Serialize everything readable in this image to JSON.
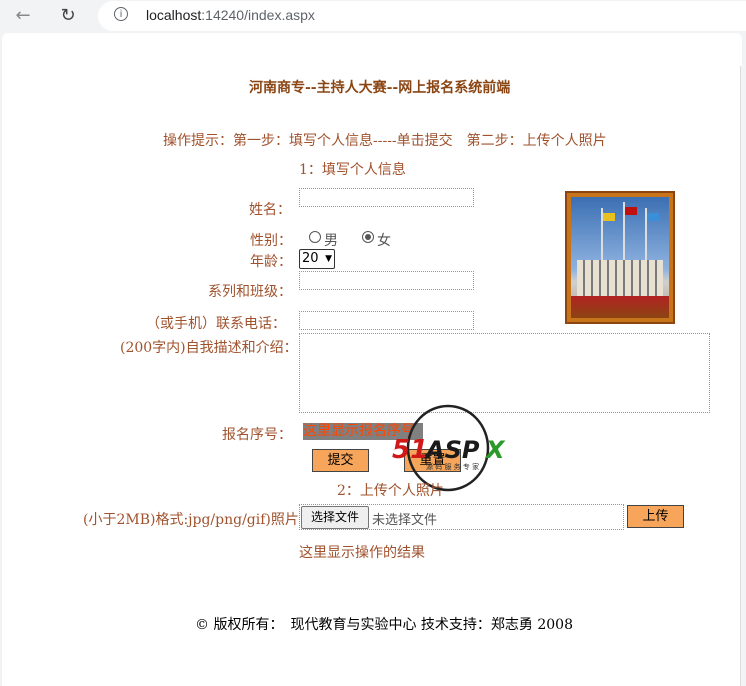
{
  "browser": {
    "url_host": "localhost",
    "url_rest": ":14240/index.aspx"
  },
  "page": {
    "title": "河南商专--主持人大赛--网上报名系统前端",
    "hint": "操作提示：第一步：填写个人信息-----单击提交　第二步：上传个人照片",
    "step1": "1：填写个人信息",
    "form": {
      "name_label": "姓名：",
      "gender_label": "性别：",
      "gender_male": "男",
      "gender_female": "女",
      "gender_selected": "女",
      "age_label": "年龄：",
      "age_value": "20",
      "class_label": "系列和班级：",
      "phone_label": "（或手机）联系电话：",
      "intro_label": "(200字内)自我描述和介绍：",
      "regno_label": "报名序号：",
      "regno_placeholder": "这里显示报名序号",
      "submit_label": "提交",
      "reset_label": "重置"
    },
    "step2": "2：上传个人照片",
    "upload": {
      "label": "(小于2MB)格式:jpg/png/gif)照片：",
      "choose_label": "选择文件",
      "no_file": "未选择文件",
      "upload_label": "上传",
      "result_text": "这里显示操作的结果"
    },
    "footer": "© 版权所有：　现代教育与实验中心 技术支持：郑志勇 2008",
    "watermark": "51ASPX 源码 服务 专家"
  },
  "colors": {
    "label": "#a0522d",
    "accent_button": "#f6a55a",
    "regno_bg": "#808080",
    "regno_text": "#ff4500"
  }
}
